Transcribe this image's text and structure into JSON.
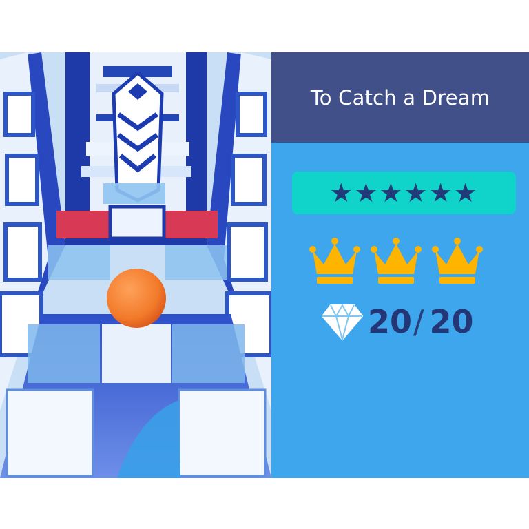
{
  "level": {
    "title": "To Catch a Dream"
  },
  "rating": {
    "stars": "★★★★★★",
    "star_count": 6
  },
  "crowns": {
    "earned": 3,
    "total": 3,
    "icon": "crown-icon",
    "color": "#ffb400"
  },
  "gems": {
    "collected": "20",
    "separator": "/",
    "total": "20",
    "icon": "diamond-icon"
  },
  "colors": {
    "header": "#425089",
    "panel": "#3ea6ec",
    "stars_bar": "#10d3c9",
    "ball": "#f27a2a"
  }
}
